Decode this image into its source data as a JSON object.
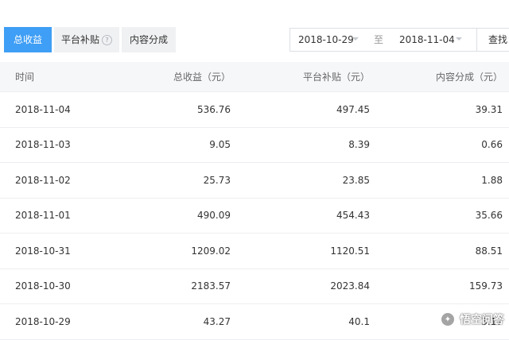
{
  "tabs": [
    {
      "label": "总收益",
      "active": true
    },
    {
      "label": "平台补贴",
      "active": false,
      "has_help_icon": true
    },
    {
      "label": "内容分成",
      "active": false
    }
  ],
  "help_icon_glyph": "?",
  "date_range": {
    "start": "2018-10-29",
    "separator": "至",
    "end": "2018-11-04",
    "query_label": "查找"
  },
  "table": {
    "columns": [
      "时间",
      "总收益（元）",
      "平台补贴（元）",
      "内容分成（元）"
    ],
    "rows": [
      {
        "date": "2018-11-04",
        "total": "536.76",
        "subsidy": "497.45",
        "share": "39.31"
      },
      {
        "date": "2018-11-03",
        "total": "9.05",
        "subsidy": "8.39",
        "share": "0.66"
      },
      {
        "date": "2018-11-02",
        "total": "25.73",
        "subsidy": "23.85",
        "share": "1.88"
      },
      {
        "date": "2018-11-01",
        "total": "490.09",
        "subsidy": "454.43",
        "share": "35.66"
      },
      {
        "date": "2018-10-31",
        "total": "1209.02",
        "subsidy": "1120.51",
        "share": "88.51"
      },
      {
        "date": "2018-10-30",
        "total": "2183.57",
        "subsidy": "2023.84",
        "share": "159.73"
      },
      {
        "date": "2018-10-29",
        "total": "43.27",
        "subsidy": "40.1",
        "share": "3.17"
      }
    ]
  },
  "watermark": {
    "text": "悟空问答",
    "logo_glyph": "✦"
  },
  "colors": {
    "accent": "#3f9ef5",
    "tab_bg": "#f0f1f3",
    "header_bg": "#f6f7f9",
    "border": "#eceef1"
  }
}
